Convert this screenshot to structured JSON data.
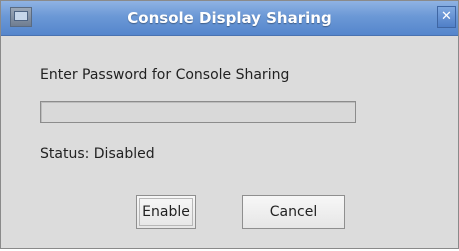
{
  "window": {
    "title": "Console Display Sharing",
    "close_label": "✕"
  },
  "dialog": {
    "prompt": "Enter Password for Console Sharing",
    "password_value": "",
    "status": "Status: Disabled"
  },
  "buttons": {
    "enable_label": "Enable",
    "cancel_label": "Cancel"
  }
}
